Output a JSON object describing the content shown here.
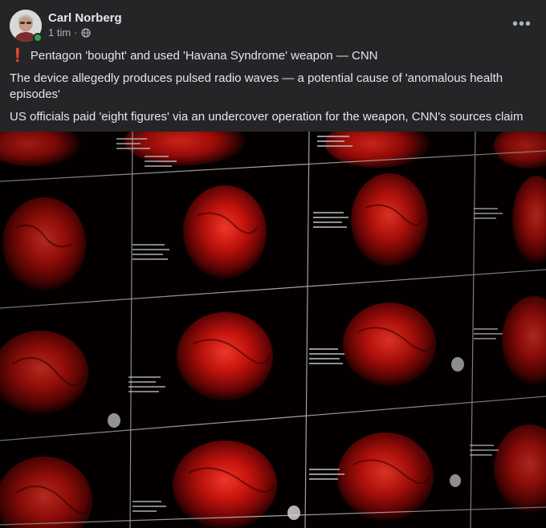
{
  "post": {
    "author": "Carl Norberg",
    "timestamp": "1 tim",
    "separator": "·",
    "privacy_icon": "globe-icon",
    "more_icon": "more-options-icon",
    "more_label": "•••",
    "headline_icon": "red-exclamation-icon",
    "headline_icon_glyph": "❗",
    "headline": "Pentagon 'bought' and used 'Havana Syndrome' weapon — CNN",
    "paragraph_1": "The device allegedly produces pulsed radio waves — a potential cause of 'anomalous health episodes'",
    "paragraph_2": "US officials paid 'eight figures' via an undercover operation for the weapon, CNN's sources claim",
    "image_icon": "mri-brain-scans-image",
    "colors": {
      "background": "#242526",
      "text_primary": "#e4e6eb",
      "text_secondary": "#b0b3b8",
      "online": "#31a24c",
      "scan_red": "#d01010"
    }
  }
}
